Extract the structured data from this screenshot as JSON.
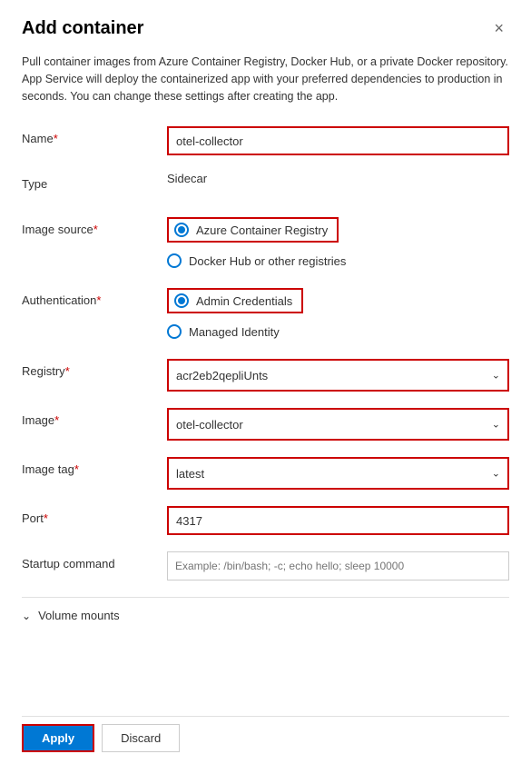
{
  "dialog": {
    "title": "Add container",
    "close_label": "×",
    "description": "Pull container images from Azure Container Registry, Docker Hub, or a private Docker repository. App Service will deploy the containerized app with your preferred dependencies to production in seconds. You can change these settings after creating the app."
  },
  "form": {
    "name_label": "Name",
    "name_required": "*",
    "name_value": "otel-collector",
    "type_label": "Type",
    "type_value": "Sidecar",
    "image_source_label": "Image source",
    "image_source_required": "*",
    "image_source_option1": "Azure Container Registry",
    "image_source_option2": "Docker Hub or other registries",
    "authentication_label": "Authentication",
    "authentication_required": "*",
    "authentication_option1": "Admin Credentials",
    "authentication_option2": "Managed Identity",
    "registry_label": "Registry",
    "registry_required": "*",
    "registry_value": "acr2eb2qepliUnts",
    "image_label": "Image",
    "image_required": "*",
    "image_value": "otel-collector",
    "image_tag_label": "Image tag",
    "image_tag_required": "*",
    "image_tag_value": "latest",
    "port_label": "Port",
    "port_required": "*",
    "port_value": "4317",
    "startup_label": "Startup command",
    "startup_placeholder": "Example: /bin/bash; -c; echo hello; sleep 10000",
    "volume_mounts_label": "Volume mounts"
  },
  "footer": {
    "apply_label": "Apply",
    "discard_label": "Discard"
  }
}
